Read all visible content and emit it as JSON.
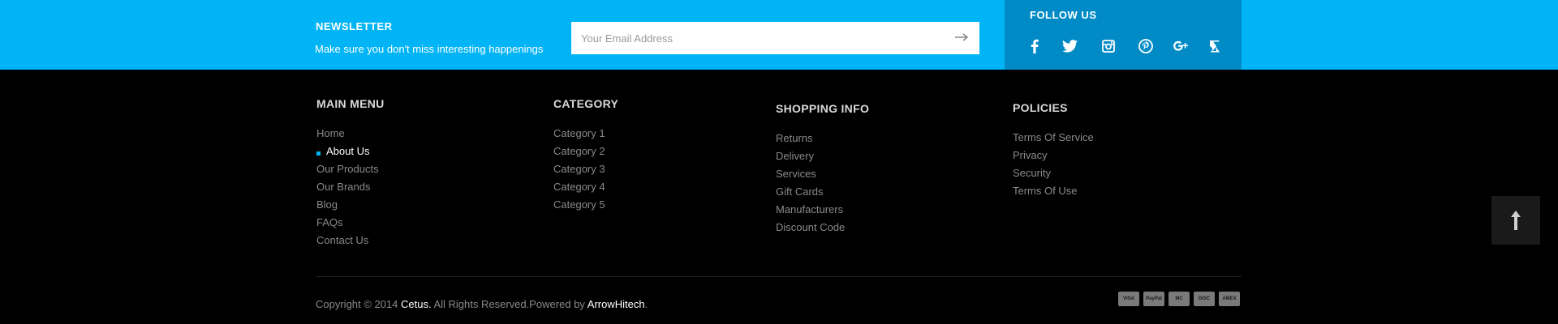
{
  "newsletter": {
    "title": "NEWSLETTER",
    "subtitle": "Make sure you don't miss interesting happenings",
    "placeholder": "Your Email Address",
    "submit_icon": "arrow-right-icon"
  },
  "follow": {
    "title": "FOLLOW US",
    "icons": [
      "facebook-icon",
      "twitter-icon",
      "instagram-icon",
      "pinterest-icon",
      "google-plus-icon",
      "delicious-icon"
    ]
  },
  "columns": {
    "main_menu": {
      "title": "MAIN MENU",
      "items": [
        "Home",
        "About Us",
        "Our Products",
        "Our Brands",
        "Blog",
        "FAQs",
        "Contact Us"
      ],
      "active": "About Us"
    },
    "category": {
      "title": "CATEGORY",
      "items": [
        "Category 1",
        "Category 2",
        "Category 3",
        "Category 4",
        "Category 5"
      ]
    },
    "shopping_info": {
      "title": "SHOPPING INFO",
      "items": [
        "Returns",
        "Delivery",
        "Services",
        "Gift Cards",
        "Manufacturers",
        "Discount Code"
      ]
    },
    "policies": {
      "title": "POLICIES",
      "items": [
        "Terms Of Service",
        "Privacy",
        "Security",
        "Terms Of Use"
      ]
    }
  },
  "copyright": {
    "prefix": "Copyright © 2014",
    "brand": "Cetus.",
    "middle": "All Rights Reserved.Powered by",
    "powered": "ArrowHitech",
    "suffix": "."
  },
  "payments": [
    "VISA",
    "PayPal",
    "MC",
    "DISC",
    "AMEX"
  ],
  "colors": {
    "accent": "#00b4f5",
    "follow_bg": "#008bc7",
    "footer_bg": "#000000",
    "link": "#8a8a8a"
  }
}
